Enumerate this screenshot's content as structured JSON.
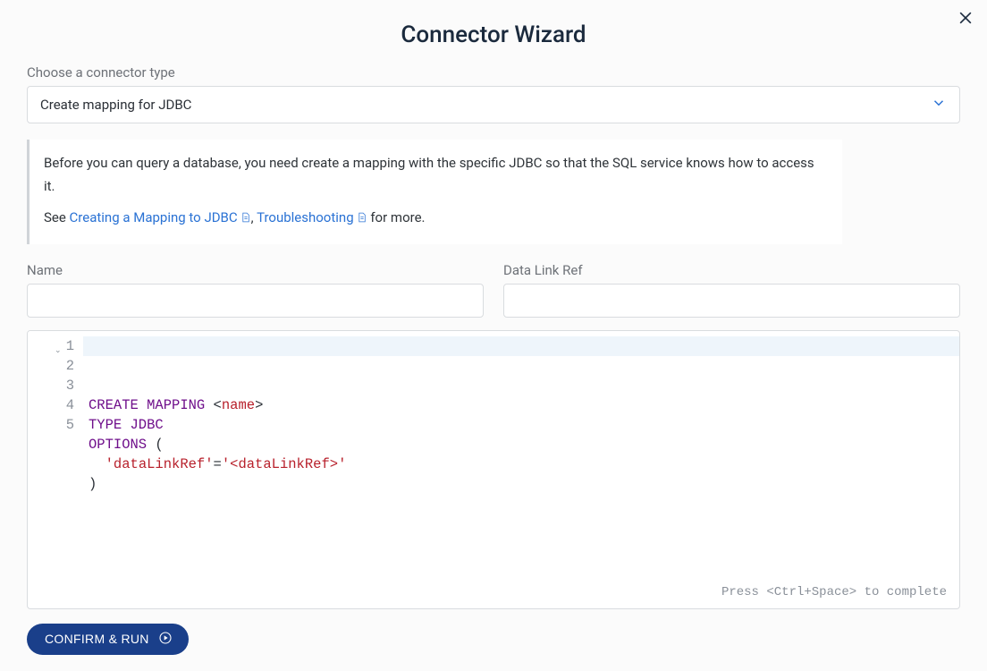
{
  "title": "Connector Wizard",
  "connector_type": {
    "label": "Choose a connector type",
    "selected": "Create mapping for JDBC"
  },
  "info": {
    "text1": "Before you can query a database, you need create a mapping with the specific JDBC so that the SQL service knows how to access it.",
    "see_prefix": "See ",
    "link1": "Creating a Mapping to JDBC",
    "sep": ", ",
    "link2": "Troubleshooting",
    "suffix": " for more."
  },
  "fields": {
    "name_label": "Name",
    "name_value": "",
    "datalink_label": "Data Link Ref",
    "datalink_value": ""
  },
  "code": {
    "line_numbers": [
      "1",
      "2",
      "3",
      "4",
      "5"
    ],
    "lines": [
      {
        "tokens": [
          {
            "t": "CREATE MAPPING ",
            "c": "kw"
          },
          {
            "t": "<",
            "c": "plain"
          },
          {
            "t": "name",
            "c": "str"
          },
          {
            "t": ">",
            "c": "plain"
          }
        ]
      },
      {
        "tokens": [
          {
            "t": "TYPE JDBC",
            "c": "kw"
          }
        ]
      },
      {
        "tokens": [
          {
            "t": "OPTIONS",
            "c": "kw"
          },
          {
            "t": " (",
            "c": "plain"
          }
        ]
      },
      {
        "tokens": [
          {
            "t": "  ",
            "c": "plain"
          },
          {
            "t": "'dataLinkRef'",
            "c": "str"
          },
          {
            "t": "=",
            "c": "plain"
          },
          {
            "t": "'<dataLinkRef>'",
            "c": "str"
          }
        ]
      },
      {
        "tokens": [
          {
            "t": ")",
            "c": "plain"
          }
        ]
      }
    ],
    "hint": "Press <Ctrl+Space> to complete"
  },
  "confirm_label": "CONFIRM & RUN"
}
